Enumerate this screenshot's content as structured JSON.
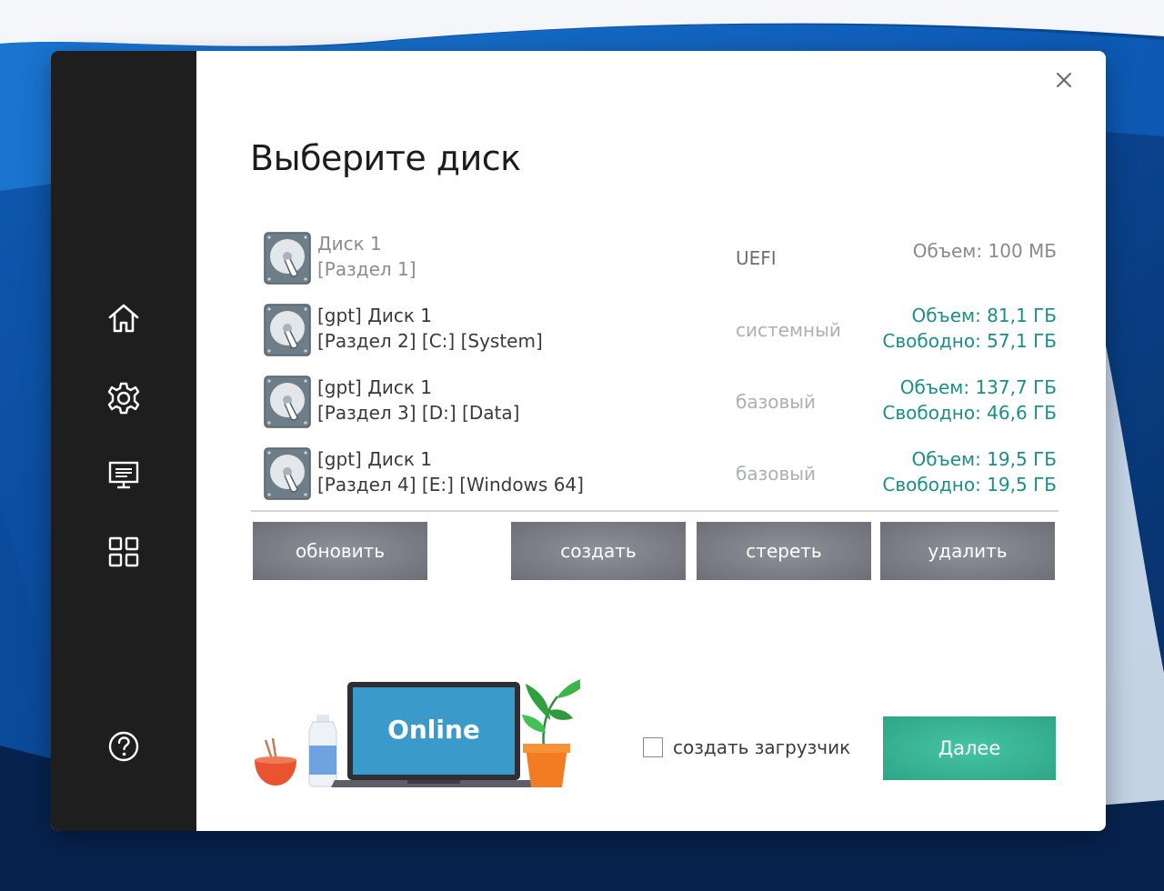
{
  "window": {
    "title": "Выберите диск",
    "close_icon": "close-icon"
  },
  "sidebar": {
    "items": [
      {
        "icon": "home-icon"
      },
      {
        "icon": "gear-icon"
      },
      {
        "icon": "monitor-icon"
      },
      {
        "icon": "grid-icon"
      },
      {
        "icon": "help-icon"
      }
    ]
  },
  "disks": [
    {
      "line1": "Диск 1",
      "line2": "[Раздел 1]",
      "type": "UEFI",
      "size": "Объем: 100 МБ",
      "free": ""
    },
    {
      "line1": "[gpt] Диск 1",
      "line2": "[Раздел 2] [C:] [System]",
      "type": "системный",
      "size": "Объем: 81,1 ГБ",
      "free": "Свободно: 57,1 ГБ"
    },
    {
      "line1": "[gpt] Диск 1",
      "line2": "[Раздел 3] [D:] [Data]",
      "type": "базовый",
      "size": "Объем: 137,7 ГБ",
      "free": "Свободно: 46,6 ГБ"
    },
    {
      "line1": "[gpt] Диск 1",
      "line2": "[Раздел 4] [E:] [Windows 64]",
      "type": "базовый",
      "size": "Объем: 19,5 ГБ",
      "free": "Свободно: 19,5 ГБ"
    }
  ],
  "actions": {
    "refresh": "обновить",
    "create": "создать",
    "erase": "стереть",
    "delete": "удалить"
  },
  "illustration": {
    "screen_text": "Online"
  },
  "footer": {
    "checkbox_label": "создать загрузчик",
    "checkbox_checked": false,
    "next_label": "Далее"
  },
  "colors": {
    "sidebar_bg": "#1e1e1e",
    "accent_green": "#33ab8c",
    "size_text": "#1a8f8a",
    "button_gray": "#7a7b85",
    "laptop_screen": "#3a9bcb"
  }
}
